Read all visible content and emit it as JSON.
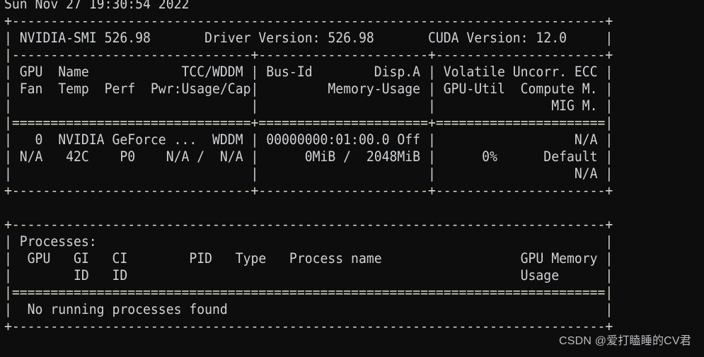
{
  "app": {
    "name": "nvidia-smi",
    "kind": "terminal-console-output",
    "background_color": "#0d0d0d",
    "text_color": "#cfd2d6"
  },
  "timestamp": {
    "raw": "Sun Nov 27 19:30:54 2022",
    "weekday": "Sun",
    "month": "Nov",
    "day": "27",
    "time": "19:30:54",
    "year": "2022"
  },
  "versions": {
    "smi_label": "NVIDIA-SMI",
    "smi_version": "526.98",
    "driver_label": "Driver Version:",
    "driver_version": "526.98",
    "cuda_label": "CUDA Version:",
    "cuda_version": "12.0"
  },
  "gpu_table": {
    "headers_row1": [
      "GPU",
      "Name",
      "TCC/WDDM",
      "Bus-Id",
      "Disp.A",
      "Volatile Uncorr. ECC"
    ],
    "headers_row2": [
      "Fan",
      "Temp",
      "Perf",
      "Pwr:Usage/Cap",
      "Memory-Usage",
      "GPU-Util",
      "Compute M."
    ],
    "headers_row3": [
      "MIG M."
    ],
    "rows": [
      {
        "index": "0",
        "name": "NVIDIA GeForce ...",
        "driver_model": "WDDM",
        "bus_id": "00000000:01:00.0",
        "disp_a": "Off",
        "ecc": "N/A",
        "fan": "N/A",
        "temp": "42C",
        "perf": "P0",
        "pwr_usage": "N/A",
        "pwr_cap": "N/A",
        "memory_used": "0MiB",
        "memory_total": "2048MiB",
        "gpu_util": "0%",
        "compute_mode": "Default",
        "mig_mode": "N/A"
      }
    ]
  },
  "processes": {
    "title": "Processes:",
    "headers_row1": [
      "GPU",
      "GI",
      "CI",
      "PID",
      "Type",
      "Process name",
      "GPU Memory"
    ],
    "headers_row2": [
      "ID",
      "ID",
      "Usage"
    ],
    "rows": [],
    "empty_message": "No running processes found"
  },
  "console_lines": [
    {
      "id": "date",
      "kind": "text",
      "text": "Sun Nov 27 19:30:54 2022"
    },
    {
      "id": "top-border",
      "kind": "rule",
      "text": "+-----------------------------------------------------------------------------+"
    },
    {
      "id": "version-row",
      "kind": "text",
      "text": "| NVIDIA-SMI 526.98       Driver Version: 526.98       CUDA Version: 12.0     |"
    },
    {
      "id": "version-sep",
      "kind": "rule",
      "text": "|-------------------------------+----------------------+----------------------+"
    },
    {
      "id": "gpu-head-1",
      "kind": "text",
      "text": "| GPU  Name            TCC/WDDM | Bus-Id        Disp.A | Volatile Uncorr. ECC |"
    },
    {
      "id": "gpu-head-2",
      "kind": "text",
      "text": "| Fan  Temp  Perf  Pwr:Usage/Cap|         Memory-Usage | GPU-Util  Compute M. |"
    },
    {
      "id": "gpu-head-3",
      "kind": "text",
      "text": "|                               |                      |               MIG M. |"
    },
    {
      "id": "gpu-head-sep",
      "kind": "rule",
      "text": "|===============================+======================+======================|"
    },
    {
      "id": "gpu-row-0-line-1",
      "kind": "text",
      "text": "|   0  NVIDIA GeForce ...  WDDM | 00000000:01:00.0 Off |                  N/A |"
    },
    {
      "id": "gpu-row-0-line-2",
      "kind": "text",
      "text": "| N/A   42C    P0    N/A /  N/A |      0MiB /  2048MiB |      0%      Default |"
    },
    {
      "id": "gpu-row-0-line-3",
      "kind": "text",
      "text": "|                               |                      |                  N/A |"
    },
    {
      "id": "gpu-bottom-border",
      "kind": "rule",
      "text": "+-------------------------------+----------------------+----------------------+"
    },
    {
      "id": "spacer-1",
      "kind": "blank",
      "text": " "
    },
    {
      "id": "proc-top-border",
      "kind": "rule",
      "text": "+-----------------------------------------------------------------------------+"
    },
    {
      "id": "proc-title",
      "kind": "text",
      "text": "| Processes:                                                                  |"
    },
    {
      "id": "proc-head-1",
      "kind": "text",
      "text": "|  GPU   GI   CI        PID   Type   Process name                  GPU Memory |"
    },
    {
      "id": "proc-head-2",
      "kind": "text",
      "text": "|        ID   ID                                                   Usage      |"
    },
    {
      "id": "proc-head-sep",
      "kind": "rule",
      "text": "|=============================================================================|"
    },
    {
      "id": "proc-empty",
      "kind": "text",
      "text": "|  No running processes found                                                 |"
    },
    {
      "id": "proc-bottom-border",
      "kind": "rule",
      "text": "+-----------------------------------------------------------------------------+"
    }
  ],
  "watermark": {
    "text": "CSDN @爱打瞌睡的CV君",
    "brand": "CSDN",
    "handle": "@爱打瞌睡的CV君",
    "color": "#b9bcc0"
  }
}
